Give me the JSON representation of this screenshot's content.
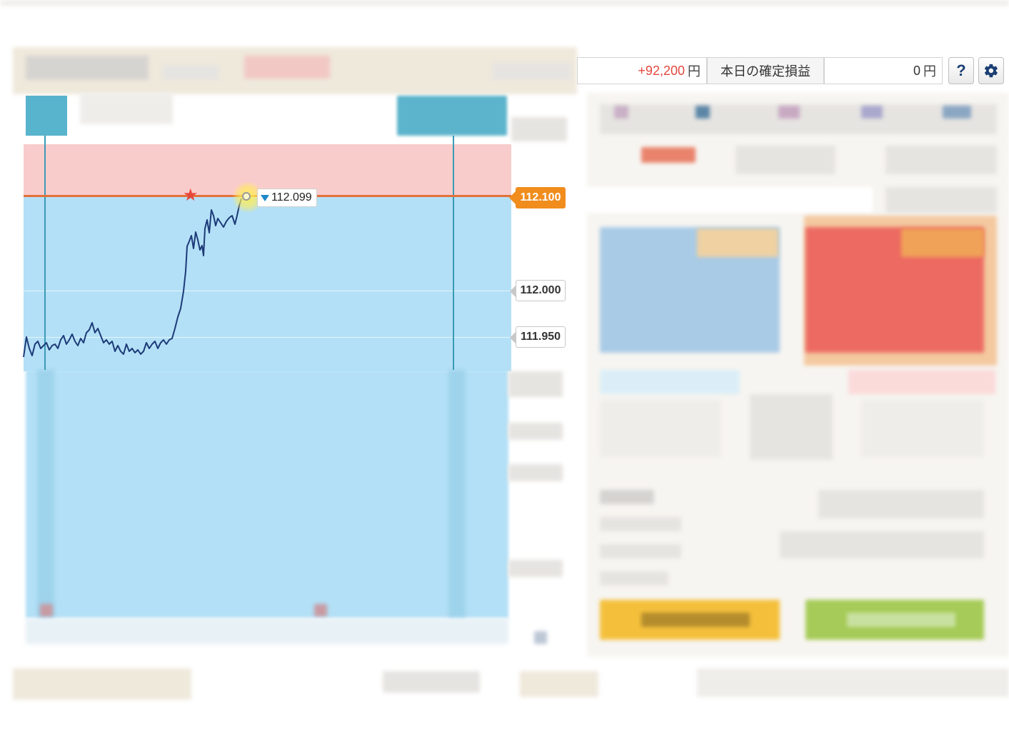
{
  "status_bar": {
    "unrealized_pl": "+92,200",
    "currency_unit": "円",
    "realized_today_label": "本日の確定損益",
    "realized_today_value": "0",
    "help_label": "?",
    "settings_icon": "gear-icon"
  },
  "chart": {
    "price_line_path": "M33,500 L37,472 L41,488 L45,498 L49,482 L53,478 L57,488 L61,484 L65,480 L69,490 L73,484 L77,482 L81,488 L85,476 L89,470 L93,482 L97,476 L101,468 L105,478 L109,484 L113,474 L117,480 L121,466 L125,462 L129,452 L133,466 L137,460 L141,470 L145,480 L149,476 L153,482 L157,478 L161,492 L165,484 L169,492 L173,496 L177,482 L181,492 L185,488 L189,494 L193,490 L197,496 L201,492 L205,480 L209,488 L213,482 L217,478 L221,488 L225,480 L229,476 L233,482 L237,476 L241,474 L245,460 L249,444 L253,432 L257,408 L260,380 L262,345 L265,338 L268,330 L271,348 L274,325 L277,336 L280,350 L283,344 L285,358 L287,320 L290,308 L293,326 L296,294 L299,302 L302,316 L305,306 L309,312 L313,318 L317,310 L321,305 L325,302 L329,314 L332,302 L335,288 L338,278",
    "current_price": "112.099",
    "rate_tag": "112.100",
    "grid_tag_1": "112.000",
    "grid_tag_2": "111.950",
    "colors": {
      "above": "#f9cccc",
      "below": "#b3e0f6",
      "rate_line": "#e2703a",
      "price_line": "#1d3a78"
    }
  }
}
